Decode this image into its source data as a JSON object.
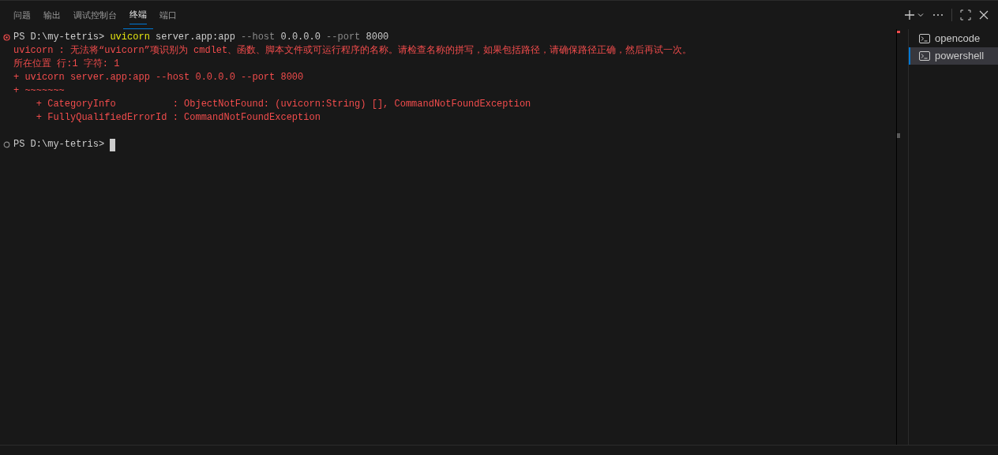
{
  "panel_tabs": [
    {
      "label": "问题",
      "selected": false
    },
    {
      "label": "输出",
      "selected": false
    },
    {
      "label": "调试控制台",
      "selected": false
    },
    {
      "label": "终端",
      "selected": true
    },
    {
      "label": "端口",
      "selected": false
    }
  ],
  "terminal": {
    "lines": [
      {
        "kind": "failed",
        "segments": [
          {
            "text": "PS D:\\my-tetris> ",
            "kind": "prompt"
          },
          {
            "text": "uvicorn",
            "kind": "command"
          },
          {
            "text": " server.app:app ",
            "kind": "prompt"
          },
          {
            "text": "--host",
            "kind": "flag"
          },
          {
            "text": " 0.0.0.0 ",
            "kind": "prompt"
          },
          {
            "text": "--port",
            "kind": "flag"
          },
          {
            "text": " 8000",
            "kind": "prompt"
          }
        ]
      },
      {
        "kind": "output",
        "segments": [
          {
            "text": "uvicorn : 无法将“uvicorn”项识别为 cmdlet、函数、脚本文件或可运行程序的名称。请检查名称的拼写，如果包括路径，请确保路径正确，然后再试一次。",
            "kind": "error"
          }
        ]
      },
      {
        "kind": "output",
        "segments": [
          {
            "text": "所在位置 行:1 字符: 1",
            "kind": "error"
          }
        ]
      },
      {
        "kind": "output",
        "segments": [
          {
            "text": "+ uvicorn server.app:app --host 0.0.0.0 --port 8000",
            "kind": "error"
          }
        ]
      },
      {
        "kind": "output",
        "segments": [
          {
            "text": "+ ~~~~~~~",
            "kind": "error"
          }
        ]
      },
      {
        "kind": "output",
        "segments": [
          {
            "text": "    + CategoryInfo          : ObjectNotFound: (uvicorn:String) [], CommandNotFoundException",
            "kind": "error"
          }
        ]
      },
      {
        "kind": "output",
        "segments": [
          {
            "text": "    + FullyQualifiedErrorId : CommandNotFoundException",
            "kind": "error"
          }
        ]
      },
      {
        "kind": "prompt",
        "segments": [
          {
            "text": "PS D:\\my-tetris> ",
            "kind": "prompt"
          }
        ],
        "cursor": true
      }
    ]
  },
  "terminal_list": [
    {
      "label": "opencode",
      "selected": false
    },
    {
      "label": "powershell",
      "selected": true
    }
  ]
}
